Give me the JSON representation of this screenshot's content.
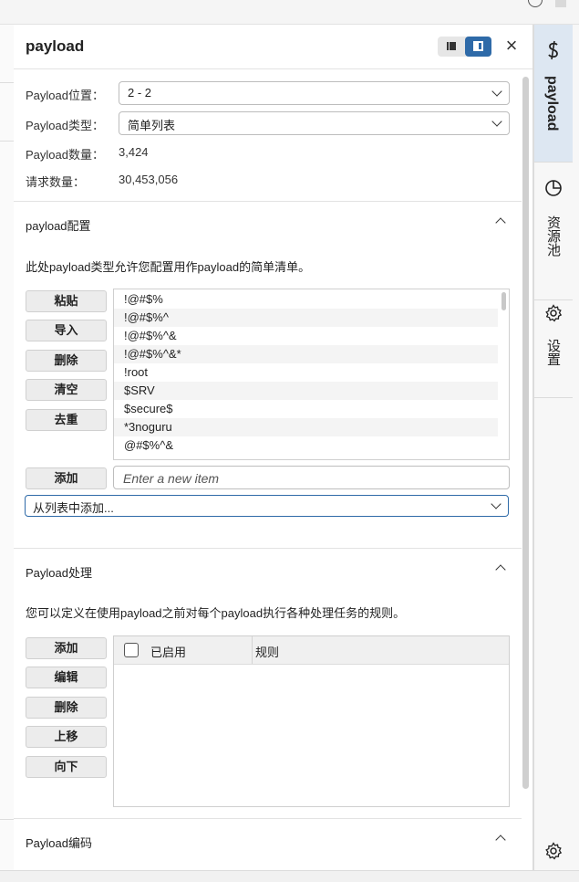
{
  "panel": {
    "title": "payload",
    "close_glyph": "×"
  },
  "config": {
    "position_label": "Payload位置：",
    "position_value": "2 - 2",
    "type_label": "Payload类型：",
    "type_value": "简单列表",
    "count_label": "Payload数量：",
    "count_value": "3,424",
    "request_label": "请求数量：",
    "request_value": "30,453,056"
  },
  "payload_config": {
    "title": "payload配置",
    "description": "此处payload类型允许您配置用作payload的简单清单。",
    "buttons": [
      "粘贴",
      "导入",
      "删除",
      "清空",
      "去重"
    ],
    "items": [
      "!@#$%",
      "!@#$%^",
      "!@#$%^&",
      "!@#$%^&*",
      "!root",
      "$SRV",
      "$secure$",
      "*3noguru",
      "@#$%^&"
    ],
    "add_label": "添加",
    "new_item_placeholder": "Enter a new item",
    "from_list_value": "从列表中添加..."
  },
  "processing": {
    "title": "Payload处理",
    "description": "您可以定义在使用payload之前对每个payload执行各种处理任务的规则。",
    "buttons": [
      "添加",
      "编辑",
      "删除",
      "上移",
      "向下"
    ],
    "col_enabled": "已启用",
    "col_rule": "规则"
  },
  "encoding": {
    "title": "Payload编码"
  },
  "sidebar": {
    "tabs": [
      {
        "label": "payload",
        "icon": "dollar-icon"
      },
      {
        "label": "资源池",
        "icon": "pie-chart-icon"
      },
      {
        "label": "设置",
        "icon": "gear-icon"
      }
    ],
    "bottom_icon": "gear-icon"
  },
  "colors": {
    "accent": "#2e6aa8",
    "active_tab": "#dde7f2"
  }
}
